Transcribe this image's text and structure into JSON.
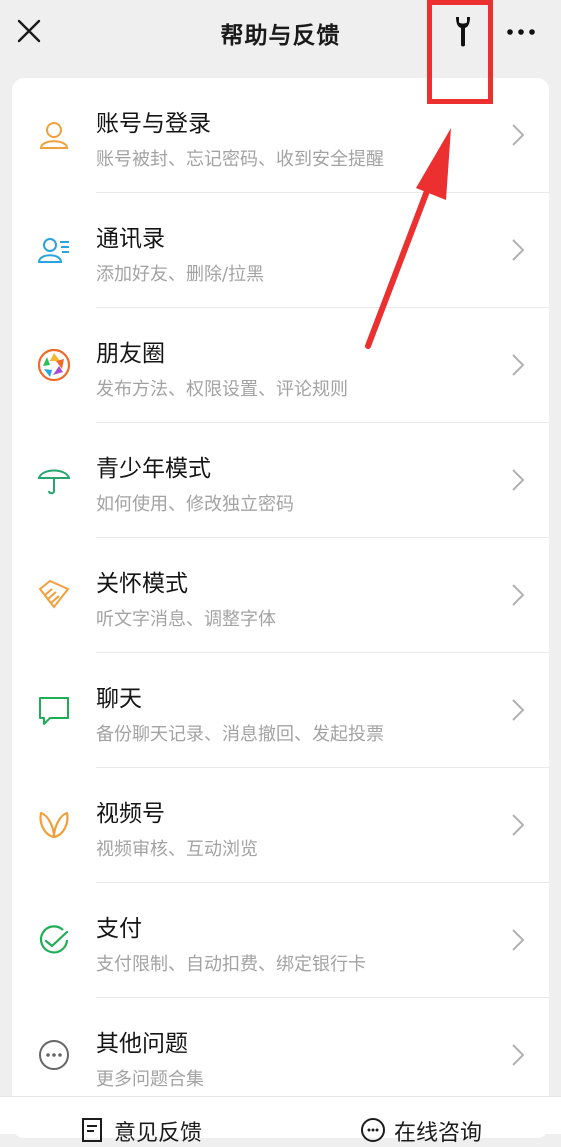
{
  "header": {
    "title": "帮助与反馈",
    "close_icon": "close-icon",
    "tool_icon": "wrench-icon",
    "more_icon": "more-icon"
  },
  "items": [
    {
      "title": "账号与登录",
      "subtitle": "账号被封、忘记密码、收到安全提醒",
      "icon": "person-icon",
      "color": "#f0a03c"
    },
    {
      "title": "通讯录",
      "subtitle": "添加好友、删除/拉黑",
      "icon": "contacts-icon",
      "color": "#2aa4e0"
    },
    {
      "title": "朋友圈",
      "subtitle": "发布方法、权限设置、评论规则",
      "icon": "moments-icon",
      "color": "#f06b2a"
    },
    {
      "title": "青少年模式",
      "subtitle": "如何使用、修改独立密码",
      "icon": "umbrella-icon",
      "color": "#24a66e"
    },
    {
      "title": "关怀模式",
      "subtitle": "听文字消息、调整字体",
      "icon": "care-icon",
      "color": "#f0a03c"
    },
    {
      "title": "聊天",
      "subtitle": "备份聊天记录、消息撤回、发起投票",
      "icon": "chat-icon",
      "color": "#1fae55"
    },
    {
      "title": "视频号",
      "subtitle": "视频审核、互动浏览",
      "icon": "channels-icon",
      "color": "#f0a03c"
    },
    {
      "title": "支付",
      "subtitle": "支付限制、自动扣费、绑定银行卡",
      "icon": "pay-icon",
      "color": "#1fae55"
    },
    {
      "title": "其他问题",
      "subtitle": "更多问题合集",
      "icon": "more-circle-icon",
      "color": "#666666"
    }
  ],
  "bottom": {
    "feedback_label": "意见反馈",
    "consult_label": "在线咨询"
  },
  "annotation": {
    "color": "#ec2f2f"
  }
}
